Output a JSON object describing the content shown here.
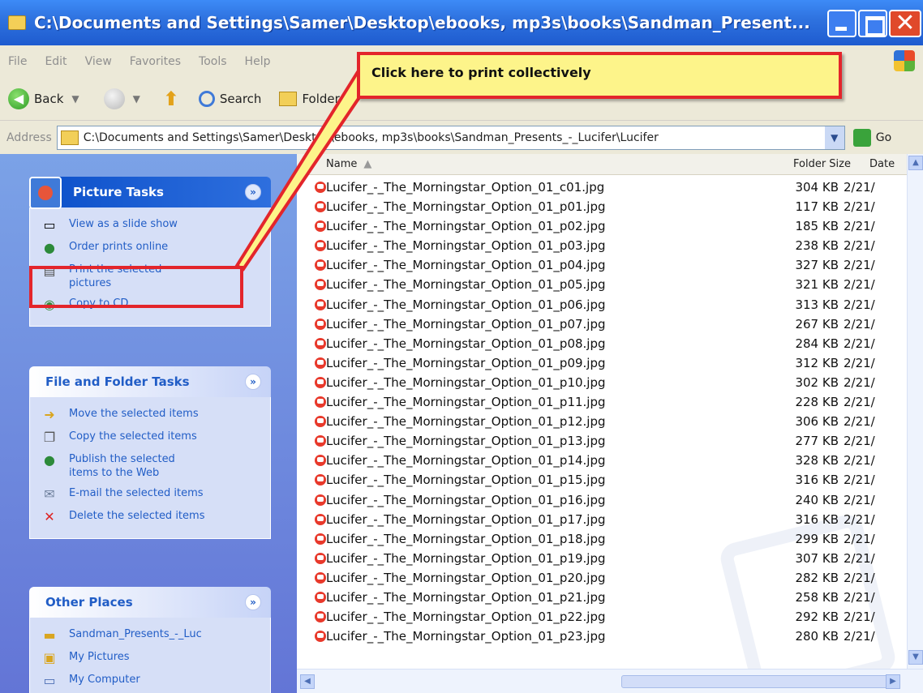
{
  "window": {
    "title": "C:\\Documents and Settings\\Samer\\Desktop\\ebooks, mp3s\\books\\Sandman_Present...",
    "close_glyph": "✕"
  },
  "menu": [
    "File",
    "Edit",
    "View",
    "Favorites",
    "Tools",
    "Help"
  ],
  "toolbar": {
    "back_label": "Back",
    "search_label": "Search",
    "folders_label": "Folders"
  },
  "address": {
    "label": "Address",
    "value": "C:\\Documents and Settings\\Samer\\Desktop\\ebooks, mp3s\\books\\Sandman_Presents_-_Lucifer\\Lucifer",
    "go_label": "Go"
  },
  "panels": {
    "picture_tasks": {
      "title": "Picture Tasks",
      "items": [
        {
          "icon": "slideshow-icon",
          "label": "View as a slide show"
        },
        {
          "icon": "globe-icon",
          "label": "Order prints online"
        },
        {
          "icon": "printer-icon",
          "label": "Print the selected pictures"
        },
        {
          "icon": "cd-icon",
          "label": "Copy to CD"
        }
      ]
    },
    "file_folder_tasks": {
      "title": "File and Folder Tasks",
      "items": [
        {
          "icon": "move-icon",
          "label": "Move the selected items"
        },
        {
          "icon": "copy-icon",
          "label": "Copy the selected items"
        },
        {
          "icon": "publish-icon",
          "label": "Publish the selected items to the Web"
        },
        {
          "icon": "email-icon",
          "label": "E-mail the selected items"
        },
        {
          "icon": "delete-icon",
          "label": "Delete the selected items"
        }
      ]
    },
    "other_places": {
      "title": "Other Places",
      "items": [
        {
          "icon": "folder-icon",
          "label": "Sandman_Presents_-_Luc"
        },
        {
          "icon": "my-pictures-icon",
          "label": "My Pictures"
        },
        {
          "icon": "my-computer-icon",
          "label": "My Computer"
        }
      ]
    },
    "collapse_glyph": "»"
  },
  "list": {
    "columns": {
      "name": "Name",
      "sort_glyph": "▲",
      "size": "Folder Size",
      "date": "Date"
    },
    "files": [
      {
        "name": "Lucifer_-_The_Morningstar_Option_01_c01.jpg",
        "size": "304 KB",
        "date": "2/21/"
      },
      {
        "name": "Lucifer_-_The_Morningstar_Option_01_p01.jpg",
        "size": "117 KB",
        "date": "2/21/"
      },
      {
        "name": "Lucifer_-_The_Morningstar_Option_01_p02.jpg",
        "size": "185 KB",
        "date": "2/21/"
      },
      {
        "name": "Lucifer_-_The_Morningstar_Option_01_p03.jpg",
        "size": "238 KB",
        "date": "2/21/"
      },
      {
        "name": "Lucifer_-_The_Morningstar_Option_01_p04.jpg",
        "size": "327 KB",
        "date": "2/21/"
      },
      {
        "name": "Lucifer_-_The_Morningstar_Option_01_p05.jpg",
        "size": "321 KB",
        "date": "2/21/"
      },
      {
        "name": "Lucifer_-_The_Morningstar_Option_01_p06.jpg",
        "size": "313 KB",
        "date": "2/21/"
      },
      {
        "name": "Lucifer_-_The_Morningstar_Option_01_p07.jpg",
        "size": "267 KB",
        "date": "2/21/"
      },
      {
        "name": "Lucifer_-_The_Morningstar_Option_01_p08.jpg",
        "size": "284 KB",
        "date": "2/21/"
      },
      {
        "name": "Lucifer_-_The_Morningstar_Option_01_p09.jpg",
        "size": "312 KB",
        "date": "2/21/"
      },
      {
        "name": "Lucifer_-_The_Morningstar_Option_01_p10.jpg",
        "size": "302 KB",
        "date": "2/21/"
      },
      {
        "name": "Lucifer_-_The_Morningstar_Option_01_p11.jpg",
        "size": "228 KB",
        "date": "2/21/"
      },
      {
        "name": "Lucifer_-_The_Morningstar_Option_01_p12.jpg",
        "size": "306 KB",
        "date": "2/21/"
      },
      {
        "name": "Lucifer_-_The_Morningstar_Option_01_p13.jpg",
        "size": "277 KB",
        "date": "2/21/"
      },
      {
        "name": "Lucifer_-_The_Morningstar_Option_01_p14.jpg",
        "size": "328 KB",
        "date": "2/21/"
      },
      {
        "name": "Lucifer_-_The_Morningstar_Option_01_p15.jpg",
        "size": "316 KB",
        "date": "2/21/"
      },
      {
        "name": "Lucifer_-_The_Morningstar_Option_01_p16.jpg",
        "size": "240 KB",
        "date": "2/21/"
      },
      {
        "name": "Lucifer_-_The_Morningstar_Option_01_p17.jpg",
        "size": "316 KB",
        "date": "2/21/"
      },
      {
        "name": "Lucifer_-_The_Morningstar_Option_01_p18.jpg",
        "size": "299 KB",
        "date": "2/21/"
      },
      {
        "name": "Lucifer_-_The_Morningstar_Option_01_p19.jpg",
        "size": "307 KB",
        "date": "2/21/"
      },
      {
        "name": "Lucifer_-_The_Morningstar_Option_01_p20.jpg",
        "size": "282 KB",
        "date": "2/21/"
      },
      {
        "name": "Lucifer_-_The_Morningstar_Option_01_p21.jpg",
        "size": "258 KB",
        "date": "2/21/"
      },
      {
        "name": "Lucifer_-_The_Morningstar_Option_01_p22.jpg",
        "size": "292 KB",
        "date": "2/21/"
      },
      {
        "name": "Lucifer_-_The_Morningstar_Option_01_p23.jpg",
        "size": "280 KB",
        "date": "2/21/"
      }
    ]
  },
  "annotation": {
    "callout_text": "Click here to print collectively",
    "accent": "#e3252b",
    "fill": "#fdf48a"
  },
  "colors": {
    "title_bar": "#2f73e0",
    "task_pane": "#6f8fe0",
    "link": "#215dc6"
  }
}
